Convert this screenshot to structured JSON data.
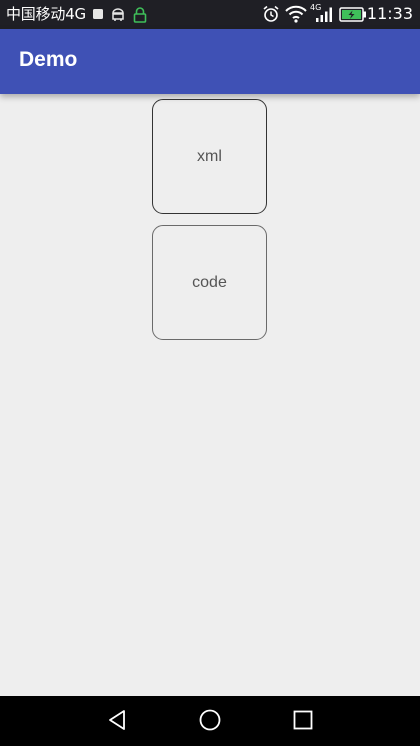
{
  "status_bar": {
    "carrier": "中国移动4G",
    "network_label": "4G",
    "time": "11:33",
    "icons": [
      "notification-square-icon",
      "android-debug-icon",
      "lock-icon",
      "alarm-icon",
      "wifi-icon",
      "signal-icon",
      "battery-charging-icon"
    ]
  },
  "app_bar": {
    "title": "Demo",
    "color": "#3f51b5"
  },
  "content": {
    "xml_button_label": "xml",
    "code_button_label": "code"
  },
  "nav_bar": {
    "icons": [
      "back-icon",
      "home-icon",
      "recents-icon"
    ]
  }
}
